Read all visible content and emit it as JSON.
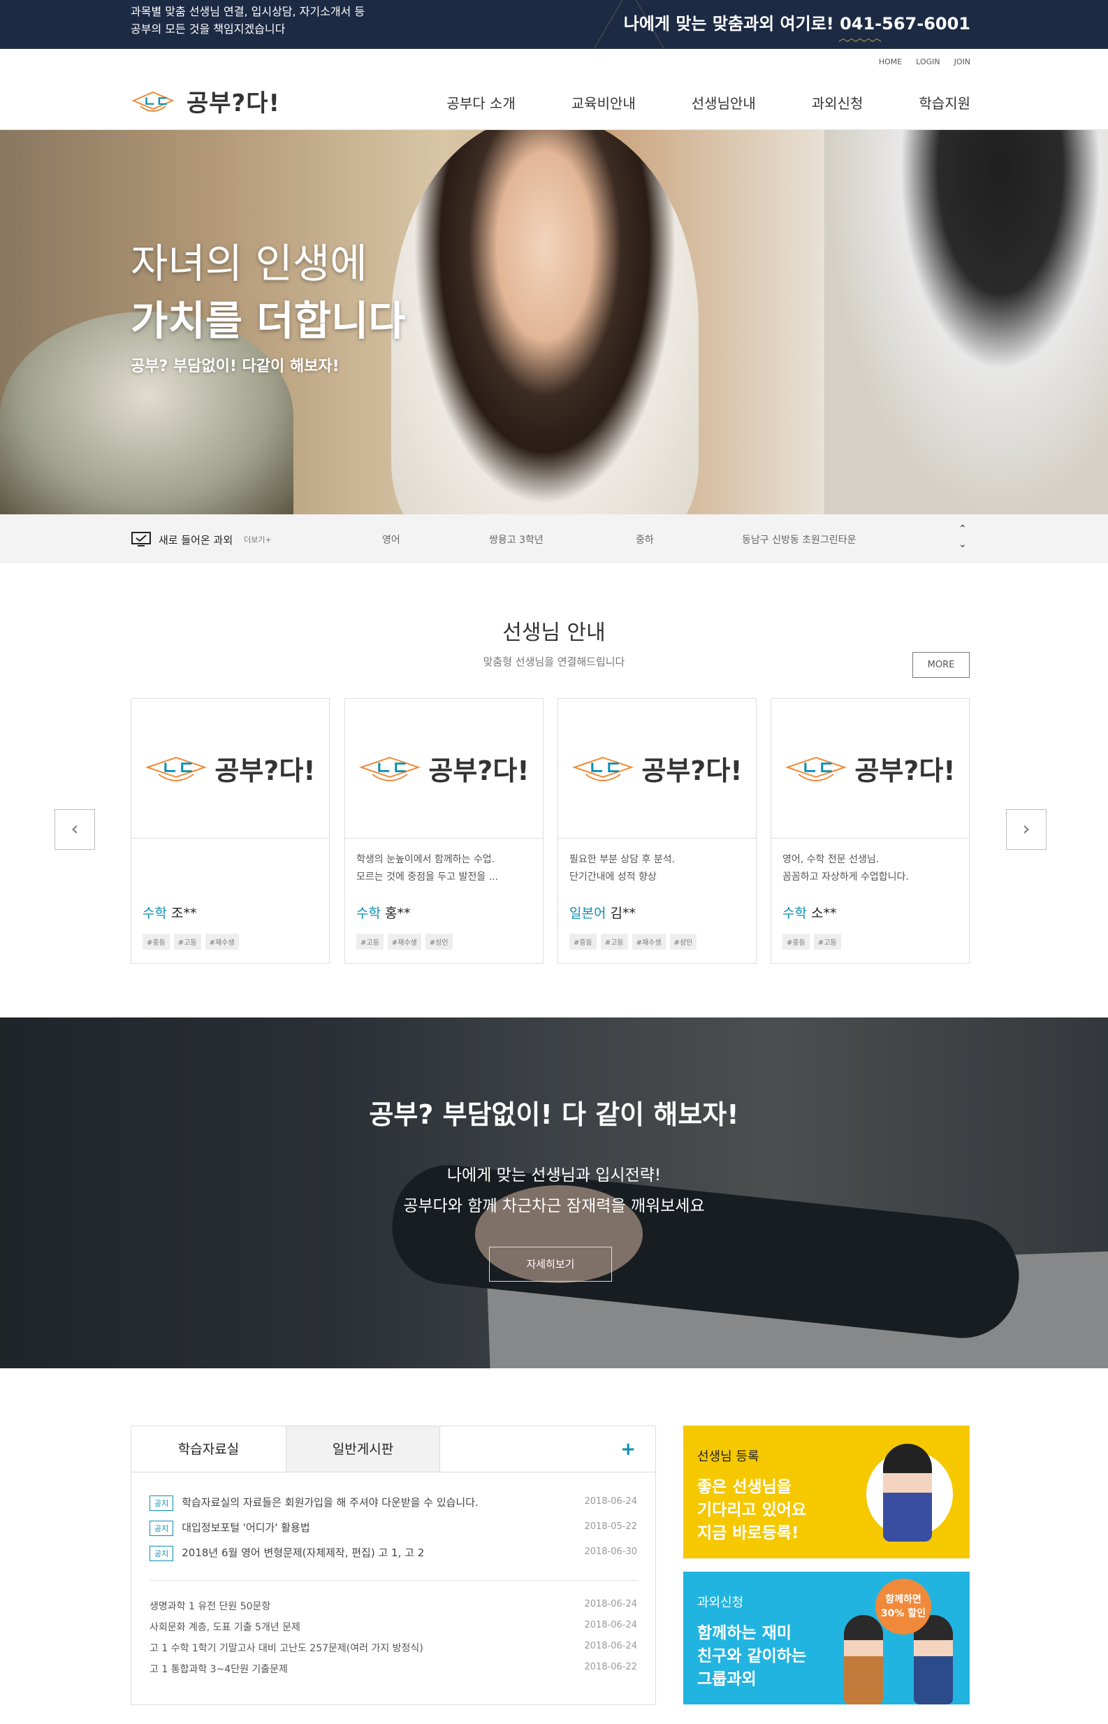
{
  "topbar": {
    "slogan_line1": "과목별 맞춤 선생님 연결, 입시상담, 자기소개서 등",
    "slogan_line2": "공부의 모든 것을 책임지겠습니다",
    "phone": "나에게 맞는 맞춤과외 여기로! 041-567-6001"
  },
  "util": [
    "HOME",
    "LOGIN",
    "JOIN"
  ],
  "logo": {
    "text": "공부?다!",
    "mark_icon": "graduation-cap-icon"
  },
  "gnb": [
    "공부다 소개",
    "교육비안내",
    "선생님안내",
    "과외신청",
    "학습지원"
  ],
  "hero": {
    "title_line1": "자녀의 인생에",
    "title_line2": "가치를 더합니다",
    "sub": "공부? 부담없이! 다같이 해보자!"
  },
  "ticker": {
    "label": "새로 들어온 과외",
    "more": "더보기+",
    "subject": "영어",
    "school": "쌍용고 3학년",
    "level": "중하",
    "area": "동남구 신방동 초원그린타운",
    "up_icon": "chevron-up-icon",
    "down_icon": "chevron-down-icon"
  },
  "teacher": {
    "title": "선생님 안내",
    "desc": "맞춤형 선생님을 연결해드립니다",
    "more": "MORE",
    "prev": "‹",
    "next": "›",
    "cards": [
      {
        "logo": "공부?다!",
        "line1": "",
        "line2": "",
        "subject": "수학",
        "name": "조**",
        "tags": [
          "#중등",
          "#고등",
          "#재수생"
        ]
      },
      {
        "logo": "공부?다!",
        "line1": "학생의 눈높이에서 함께하는 수업.",
        "line2": "모르는 것에 중점을 두고 발전을 ...",
        "subject": "수학",
        "name": "홍**",
        "tags": [
          "#고등",
          "#재수생",
          "#성인"
        ]
      },
      {
        "logo": "공부?다!",
        "line1": "필요한 부분 상담 후 분석.",
        "line2": "단기간내에 성적 향상",
        "subject": "일본어",
        "name": "김**",
        "tags": [
          "#중등",
          "#고등",
          "#재수생",
          "#성인"
        ]
      },
      {
        "logo": "공부?다!",
        "line1": "영어, 수학 전문 선생님.",
        "line2": "꼼꼼하고 자상하게 수업합니다.",
        "subject": "수학",
        "name": "소**",
        "tags": [
          "#중등",
          "#고등"
        ]
      }
    ]
  },
  "banner": {
    "title": "공부? 부담없이! 다 같이 해보자!",
    "line1": "나에게 맞는 선생님과 입시전략!",
    "line2": "공부다와 함께 차근차근 잠재력을 깨워보세요",
    "button": "자세히보기"
  },
  "board": {
    "tab1": "학습자료실",
    "tab2": "일반게시판",
    "plus": "+",
    "notices": [
      {
        "badge": "공지",
        "title": "학습자료실의 자료들은 회원가입을 해 주셔야 다운받을 수 있습니다.",
        "date": "2018-06-24"
      },
      {
        "badge": "공지",
        "title": "대입정보포털 '어디가' 활용법",
        "date": "2018-05-22"
      },
      {
        "badge": "공지",
        "title": "2018년 6월 영어 변형문제(자체제작, 편집) 고 1, 고 2",
        "date": "2018-06-30"
      }
    ],
    "posts": [
      {
        "title": "생명과학 1 유전 단원 50문항",
        "date": "2018-06-24"
      },
      {
        "title": "사회문화 계층, 도표 기출 5개년 문제",
        "date": "2018-06-24"
      },
      {
        "title": "고 1 수학 1학기 기말고사 대비 고난도 257문제(여러 가지 방정식)",
        "date": "2018-06-24"
      },
      {
        "title": "고 1 통합과학 3~4단원 기출문제",
        "date": "2018-06-22"
      }
    ]
  },
  "side": {
    "teacher_reg": {
      "cat": "선생님 등록",
      "line1": "좋은 선생님을",
      "line2": "기다리고 있어요",
      "line3": "지금 바로등록!"
    },
    "group": {
      "cat": "과외신청",
      "line1": "함께하는 재미",
      "line2": "친구와 같이하는",
      "line3": "그룹과외",
      "badge1": "함께하면",
      "badge2": "30% 할인"
    }
  },
  "colors": {
    "accent": "#0a8fb5",
    "topbar": "#1c2a44",
    "yellow": "#f5c800",
    "blue": "#22b4e0"
  }
}
